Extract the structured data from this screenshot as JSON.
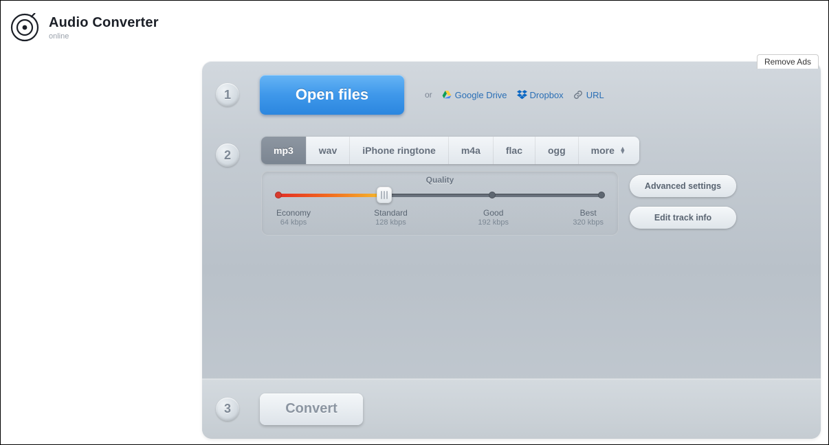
{
  "brand": {
    "title": "Audio Converter",
    "subtitle": "online"
  },
  "remove_ads": "Remove Ads",
  "step1": {
    "num": "1",
    "open_files": "Open files",
    "or": "or",
    "google_drive": "Google Drive",
    "dropbox": "Dropbox",
    "url": "URL"
  },
  "step2": {
    "num": "2",
    "formats": {
      "mp3": "mp3",
      "wav": "wav",
      "iphone": "iPhone ringtone",
      "m4a": "m4a",
      "flac": "flac",
      "ogg": "ogg",
      "more": "more"
    },
    "quality": {
      "title": "Quality",
      "economy": {
        "label": "Economy",
        "rate": "64 kbps"
      },
      "standard": {
        "label": "Standard",
        "rate": "128 kbps"
      },
      "good": {
        "label": "Good",
        "rate": "192 kbps"
      },
      "best": {
        "label": "Best",
        "rate": "320 kbps"
      }
    },
    "advanced": "Advanced settings",
    "edit_track": "Edit track info"
  },
  "step3": {
    "num": "3",
    "convert": "Convert"
  }
}
